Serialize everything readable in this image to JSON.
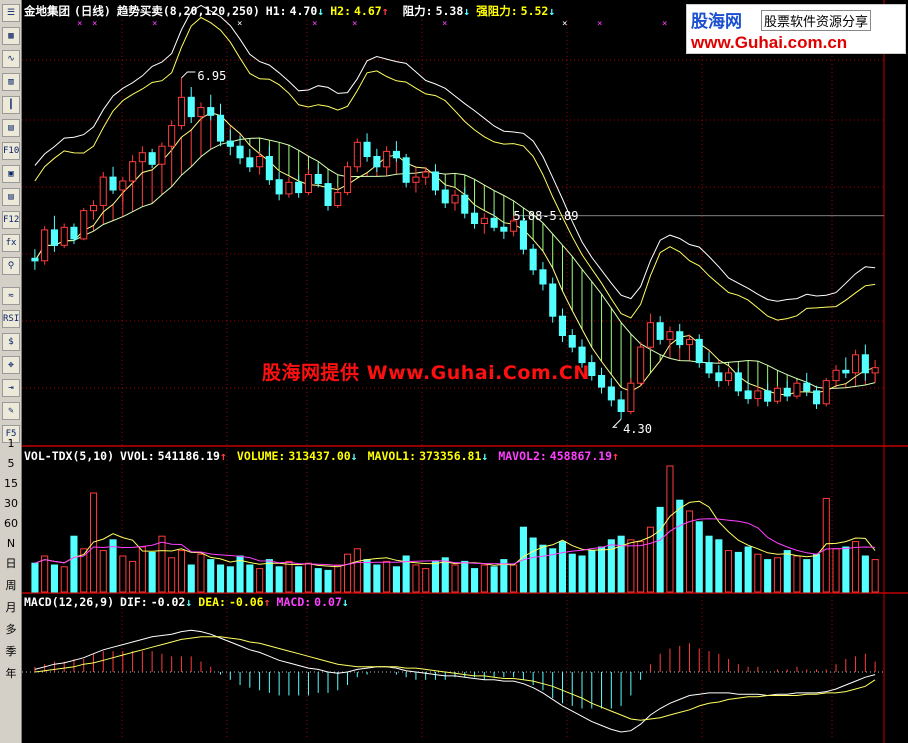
{
  "toolbar": {
    "icons": [
      "list-icon",
      "table-icon",
      "trend-icon",
      "bar-icon",
      "candle-icon",
      "grid-icon",
      "f10-icon",
      "report-icon",
      "doc-icon",
      "f12-icon",
      "fx-icon",
      "search-icon",
      "ma-icon",
      "rsi-icon",
      "tool-icon",
      "move-icon",
      "exit-icon",
      "pen-icon",
      "f5-icon"
    ],
    "btn_labels": {
      "f10": "F10",
      "f12": "F12",
      "rsi": "RSI",
      "f5": "F5"
    },
    "periods": [
      "1",
      "5",
      "15",
      "30",
      "60",
      "N",
      "日",
      "周",
      "月",
      "多",
      "季",
      "年"
    ]
  },
  "header": {
    "stock": "金地集团",
    "period": "(日线)",
    "indicator": "趋势买卖(8,20,120,250)",
    "h1_label": "H1:",
    "h1_value": "4.70",
    "h1_arrow": "↓",
    "h2_label": "H2:",
    "h2_value": "4.67",
    "h2_arrow": "↑",
    "resist_label": "阻力:",
    "resist_value": "5.38",
    "resist_arrow": "↓",
    "strong_label": "强阻力:",
    "strong_value": "5.52",
    "strong_arrow": "↓"
  },
  "annotations": {
    "high": "6.95",
    "low": "4.30",
    "mid": "5.88-5.89"
  },
  "volume_header": {
    "title": "VOL-TDX(5,10)",
    "vvol_label": "VVOL:",
    "vvol_value": "541186.19",
    "vvol_arrow": "↑",
    "volume_label": "VOLUME:",
    "volume_value": "313437.00",
    "volume_arrow": "↓",
    "mavol1_label": "MAVOL1:",
    "mavol1_value": "373356.81",
    "mavol1_arrow": "↓",
    "mavol2_label": "MAVOL2:",
    "mavol2_value": "458867.19",
    "mavol2_arrow": "↑"
  },
  "macd_header": {
    "title": "MACD(12,26,9)",
    "dif_label": "DIF:",
    "dif_value": "-0.02",
    "dif_arrow": "↓",
    "dea_label": "DEA:",
    "dea_value": "-0.06",
    "dea_arrow": "↑",
    "macd_label": "MACD:",
    "macd_value": "0.07",
    "macd_arrow": "↓"
  },
  "watermark": {
    "logo_title": "股海网",
    "logo_sub": "股票软件资源分享",
    "logo_url": "www.Guhai.com.cn",
    "center": "股海网提供 Www.Guhai.Com.CN"
  },
  "colors": {
    "up": "#ff3c3c",
    "down": "#54ffff",
    "grid": "#a00000",
    "header_white": "#ffffff",
    "header_yellow": "#ffff00",
    "header_magenta": "#ff40ff"
  },
  "chart_data": {
    "type": "candlestick",
    "price_range": [
      4.1,
      7.4
    ],
    "ref_line": 5.88,
    "candles": [
      [
        5.55,
        5.62,
        5.46,
        5.53
      ],
      [
        5.53,
        5.8,
        5.5,
        5.77
      ],
      [
        5.77,
        5.88,
        5.6,
        5.65
      ],
      [
        5.65,
        5.82,
        5.63,
        5.79
      ],
      [
        5.79,
        5.82,
        5.66,
        5.7
      ],
      [
        5.7,
        5.94,
        5.69,
        5.92
      ],
      [
        5.92,
        6.0,
        5.85,
        5.96
      ],
      [
        5.96,
        6.22,
        5.92,
        6.18
      ],
      [
        6.18,
        6.26,
        6.05,
        6.08
      ],
      [
        6.08,
        6.18,
        5.98,
        6.15
      ],
      [
        6.15,
        6.35,
        6.1,
        6.3
      ],
      [
        6.3,
        6.42,
        6.22,
        6.37
      ],
      [
        6.37,
        6.4,
        6.25,
        6.28
      ],
      [
        6.28,
        6.45,
        6.25,
        6.42
      ],
      [
        6.42,
        6.62,
        6.38,
        6.58
      ],
      [
        6.58,
        6.95,
        6.55,
        6.8
      ],
      [
        6.8,
        6.88,
        6.6,
        6.65
      ],
      [
        6.65,
        6.76,
        6.58,
        6.72
      ],
      [
        6.72,
        6.82,
        6.62,
        6.66
      ],
      [
        6.66,
        6.75,
        6.42,
        6.46
      ],
      [
        6.46,
        6.55,
        6.35,
        6.42
      ],
      [
        6.42,
        6.5,
        6.28,
        6.33
      ],
      [
        6.33,
        6.4,
        6.22,
        6.26
      ],
      [
        6.26,
        6.38,
        6.2,
        6.34
      ],
      [
        6.34,
        6.42,
        6.12,
        6.16
      ],
      [
        6.16,
        6.22,
        6.0,
        6.05
      ],
      [
        6.05,
        6.18,
        6.02,
        6.14
      ],
      [
        6.14,
        6.2,
        6.02,
        6.06
      ],
      [
        6.06,
        6.24,
        6.04,
        6.2
      ],
      [
        6.2,
        6.28,
        6.1,
        6.13
      ],
      [
        6.13,
        6.16,
        5.92,
        5.96
      ],
      [
        5.96,
        6.1,
        5.94,
        6.06
      ],
      [
        6.06,
        6.3,
        6.04,
        6.26
      ],
      [
        6.26,
        6.48,
        6.22,
        6.45
      ],
      [
        6.45,
        6.52,
        6.3,
        6.34
      ],
      [
        6.34,
        6.4,
        6.22,
        6.26
      ],
      [
        6.26,
        6.42,
        6.24,
        6.38
      ],
      [
        6.38,
        6.46,
        6.3,
        6.33
      ],
      [
        6.33,
        6.36,
        6.1,
        6.14
      ],
      [
        6.14,
        6.22,
        6.06,
        6.18
      ],
      [
        6.18,
        6.26,
        6.12,
        6.22
      ],
      [
        6.22,
        6.28,
        6.04,
        6.08
      ],
      [
        6.08,
        6.12,
        5.94,
        5.98
      ],
      [
        5.98,
        6.08,
        5.92,
        6.04
      ],
      [
        6.04,
        6.1,
        5.86,
        5.9
      ],
      [
        5.9,
        5.96,
        5.78,
        5.82
      ],
      [
        5.82,
        5.9,
        5.74,
        5.86
      ],
      [
        5.86,
        5.92,
        5.76,
        5.79
      ],
      [
        5.79,
        5.84,
        5.7,
        5.76
      ],
      [
        5.76,
        5.88,
        5.72,
        5.84
      ],
      [
        5.84,
        5.89,
        5.58,
        5.62
      ],
      [
        5.62,
        5.66,
        5.42,
        5.46
      ],
      [
        5.46,
        5.52,
        5.3,
        5.35
      ],
      [
        5.35,
        5.4,
        5.05,
        5.1
      ],
      [
        5.1,
        5.16,
        4.9,
        4.95
      ],
      [
        4.95,
        5.0,
        4.82,
        4.86
      ],
      [
        4.86,
        4.92,
        4.7,
        4.74
      ],
      [
        4.74,
        4.8,
        4.6,
        4.64
      ],
      [
        4.64,
        4.7,
        4.5,
        4.55
      ],
      [
        4.55,
        4.62,
        4.4,
        4.45
      ],
      [
        4.45,
        4.52,
        4.3,
        4.36
      ],
      [
        4.36,
        4.62,
        4.34,
        4.58
      ],
      [
        4.58,
        4.9,
        4.56,
        4.86
      ],
      [
        4.86,
        5.12,
        4.84,
        5.05
      ],
      [
        5.05,
        5.1,
        4.88,
        4.92
      ],
      [
        4.92,
        5.02,
        4.86,
        4.98
      ],
      [
        4.98,
        5.04,
        4.85,
        4.88
      ],
      [
        4.88,
        4.96,
        4.8,
        4.92
      ],
      [
        4.92,
        4.96,
        4.7,
        4.74
      ],
      [
        4.74,
        4.82,
        4.62,
        4.66
      ],
      [
        4.66,
        4.72,
        4.55,
        4.6
      ],
      [
        4.6,
        4.7,
        4.56,
        4.66
      ],
      [
        4.66,
        4.7,
        4.48,
        4.52
      ],
      [
        4.52,
        4.6,
        4.42,
        4.46
      ],
      [
        4.46,
        4.56,
        4.4,
        4.52
      ],
      [
        4.52,
        4.58,
        4.4,
        4.44
      ],
      [
        4.44,
        4.56,
        4.42,
        4.54
      ],
      [
        4.54,
        4.6,
        4.44,
        4.48
      ],
      [
        4.48,
        4.6,
        4.46,
        4.58
      ],
      [
        4.58,
        4.66,
        4.48,
        4.52
      ],
      [
        4.52,
        4.56,
        4.38,
        4.42
      ],
      [
        4.42,
        4.62,
        4.4,
        4.6
      ],
      [
        4.6,
        4.72,
        4.56,
        4.68
      ],
      [
        4.68,
        4.78,
        4.62,
        4.66
      ],
      [
        4.66,
        4.84,
        4.64,
        4.8
      ],
      [
        4.8,
        4.88,
        4.6,
        4.66
      ],
      [
        4.66,
        4.76,
        4.58,
        4.7
      ]
    ],
    "volume": [
      32,
      40,
      30,
      28,
      62,
      48,
      110,
      46,
      58,
      40,
      34,
      50,
      44,
      62,
      38,
      46,
      30,
      42,
      36,
      30,
      28,
      40,
      30,
      26,
      36,
      28,
      34,
      28,
      32,
      26,
      24,
      30,
      42,
      48,
      36,
      30,
      34,
      28,
      40,
      30,
      26,
      34,
      38,
      30,
      34,
      26,
      30,
      28,
      36,
      30,
      72,
      60,
      52,
      48,
      56,
      42,
      40,
      46,
      50,
      58,
      62,
      58,
      56,
      72,
      94,
      140,
      102,
      90,
      78,
      62,
      58,
      46,
      44,
      50,
      42,
      36,
      38,
      46,
      40,
      36,
      42,
      104,
      48,
      50,
      56,
      40,
      36
    ],
    "macd_dif": [
      0.02,
      0.04,
      0.06,
      0.07,
      0.09,
      0.11,
      0.14,
      0.17,
      0.19,
      0.21,
      0.23,
      0.25,
      0.27,
      0.28,
      0.29,
      0.31,
      0.32,
      0.31,
      0.29,
      0.26,
      0.23,
      0.2,
      0.17,
      0.15,
      0.12,
      0.09,
      0.07,
      0.05,
      0.03,
      0.02,
      0.0,
      -0.01,
      0.0,
      0.02,
      0.03,
      0.04,
      0.04,
      0.03,
      0.01,
      0.0,
      -0.01,
      -0.02,
      -0.03,
      -0.03,
      -0.04,
      -0.05,
      -0.06,
      -0.06,
      -0.07,
      -0.07,
      -0.09,
      -0.12,
      -0.16,
      -0.21,
      -0.26,
      -0.3,
      -0.34,
      -0.38,
      -0.41,
      -0.44,
      -0.46,
      -0.45,
      -0.4,
      -0.33,
      -0.28,
      -0.24,
      -0.21,
      -0.18,
      -0.17,
      -0.16,
      -0.16,
      -0.16,
      -0.17,
      -0.17,
      -0.17,
      -0.18,
      -0.17,
      -0.17,
      -0.16,
      -0.16,
      -0.16,
      -0.15,
      -0.13,
      -0.1,
      -0.07,
      -0.04,
      -0.02
    ],
    "macd_dea": [
      0.0,
      0.01,
      0.02,
      0.03,
      0.04,
      0.06,
      0.07,
      0.09,
      0.11,
      0.13,
      0.15,
      0.17,
      0.19,
      0.21,
      0.23,
      0.25,
      0.26,
      0.27,
      0.27,
      0.27,
      0.26,
      0.25,
      0.23,
      0.22,
      0.2,
      0.18,
      0.16,
      0.14,
      0.12,
      0.1,
      0.08,
      0.06,
      0.05,
      0.04,
      0.04,
      0.04,
      0.04,
      0.04,
      0.03,
      0.03,
      0.02,
      0.01,
      0.0,
      -0.01,
      -0.02,
      -0.03,
      -0.03,
      -0.04,
      -0.05,
      -0.05,
      -0.06,
      -0.07,
      -0.09,
      -0.11,
      -0.14,
      -0.17,
      -0.2,
      -0.24,
      -0.27,
      -0.3,
      -0.33,
      -0.36,
      -0.37,
      -0.36,
      -0.35,
      -0.33,
      -0.31,
      -0.29,
      -0.26,
      -0.24,
      -0.23,
      -0.21,
      -0.2,
      -0.19,
      -0.19,
      -0.18,
      -0.18,
      -0.18,
      -0.18,
      -0.17,
      -0.17,
      -0.16,
      -0.16,
      -0.15,
      -0.13,
      -0.11,
      -0.06
    ]
  }
}
